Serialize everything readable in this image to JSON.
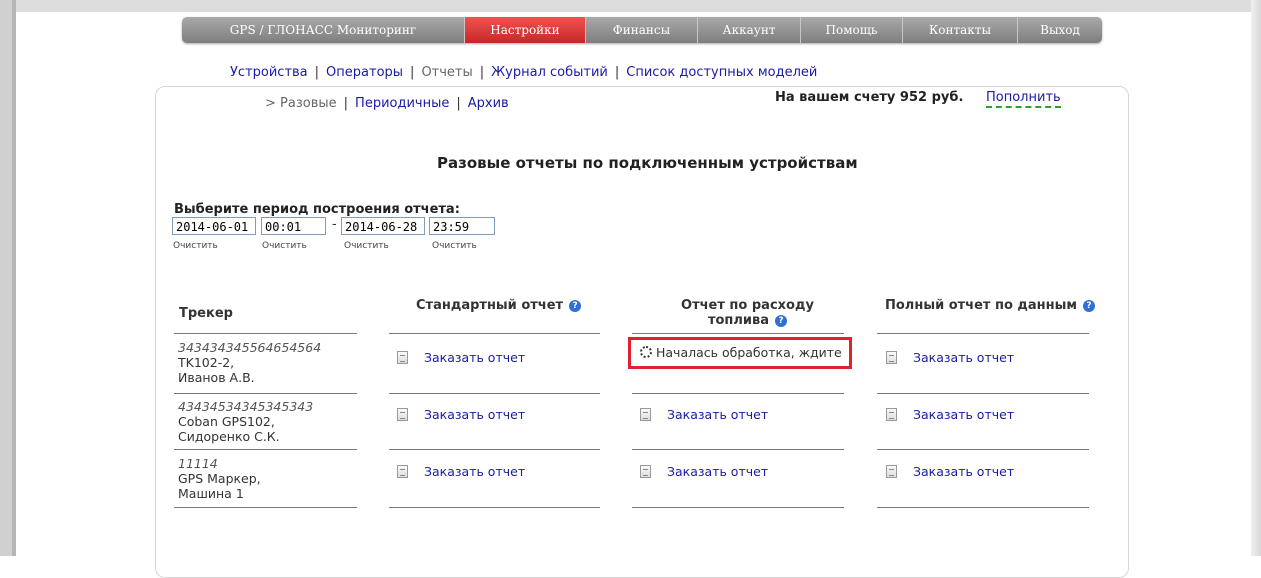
{
  "nav": [
    {
      "label": "GPS / ГЛОНАСС Мониторинг",
      "active": false
    },
    {
      "label": "Настройки",
      "active": true
    },
    {
      "label": "Финансы",
      "active": false
    },
    {
      "label": "Аккаунт",
      "active": false
    },
    {
      "label": "Помощь",
      "active": false
    },
    {
      "label": "Контакты",
      "active": false
    },
    {
      "label": "Выход",
      "active": false
    }
  ],
  "subnav": {
    "devices": "Устройства",
    "operators": "Операторы",
    "reports": "Отчеты",
    "events": "Журнал событий",
    "models": "Список доступных моделей"
  },
  "tabs": {
    "prefix": ">",
    "single": "Разовые",
    "periodic": "Периодичные",
    "archive": "Архив"
  },
  "balance": {
    "text": "На вашем счету 952 руб.",
    "topup": "Пополнить"
  },
  "page_title": "Разовые отчеты по подключенным устройствам",
  "period": {
    "label": "Выберите период построения отчета:",
    "start_date": "2014-06-01",
    "start_time": "00:01",
    "dash": "-",
    "end_date": "2014-06-28",
    "end_time": "23:59",
    "clear": "Очистить"
  },
  "table": {
    "headers": {
      "tracker": "Трекер",
      "standard": "Стандартный отчет",
      "fuel_line1": "Отчет по расходу",
      "fuel_line2": "топлива",
      "full": "Полный отчет по данным"
    },
    "help_glyph": "?",
    "rows": [
      {
        "id": "343434345564654564",
        "model": "TK102-2,",
        "owner": "Иванов А.В."
      },
      {
        "id": "43434534345345343",
        "model": "Coban GPS102,",
        "owner": "Сидоренко С.К."
      },
      {
        "id": "11114",
        "model": "GPS Маркер,",
        "owner": "Машина 1"
      }
    ],
    "order_label": "Заказать отчет",
    "processing_label": "Началась обработка, ждите"
  },
  "colors": {
    "nav_active": "#d32f2f",
    "link": "#1a1aa6",
    "highlight_border": "#e1212b"
  },
  "icons": [
    "document-icon",
    "help-icon",
    "spinner-icon"
  ]
}
